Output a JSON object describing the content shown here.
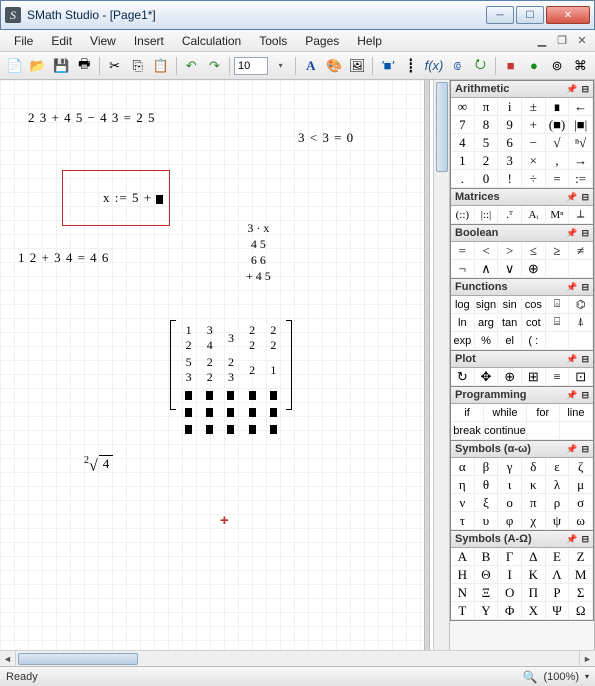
{
  "window": {
    "title": "SMath Studio - [Page1*]",
    "app_icon_letter": "S"
  },
  "menu": {
    "items": [
      "File",
      "Edit",
      "View",
      "Insert",
      "Calculation",
      "Tools",
      "Pages",
      "Help"
    ]
  },
  "toolbar": {
    "font_size": "10"
  },
  "canvas": {
    "expr1": "2 3 + 4 5 − 4 3 = 2 5",
    "expr2": "3 < 3 = 0",
    "sel_expr": "x := 5 + ",
    "expr3": "1 2 + 3 4 = 4 6",
    "col_lines": [
      "3 · x",
      "4 5",
      "6 6",
      "+ 4 5"
    ],
    "sqrt_idx": "2",
    "sqrt_arg": "4",
    "matrix": [
      [
        "1 2",
        "3 4",
        "3",
        "2 2",
        "2 2"
      ],
      [
        "5 3",
        "2 2",
        "2 3",
        "2",
        "1"
      ],
      [
        "■",
        "■",
        "■",
        "■",
        "■"
      ],
      [
        "■",
        "■",
        "■",
        "■",
        "■"
      ],
      [
        "■",
        "■",
        "■",
        "■",
        "■"
      ]
    ]
  },
  "panels": {
    "arithmetic": {
      "title": "Arithmetic",
      "rows": [
        [
          "∞",
          "π",
          "i",
          "±",
          "∎",
          "←"
        ],
        [
          "7",
          "8",
          "9",
          "+",
          "(■)",
          "|■|"
        ],
        [
          "4",
          "5",
          "6",
          "−",
          "√",
          "ⁿ√"
        ],
        [
          "1",
          "2",
          "3",
          "×",
          ",",
          "→"
        ],
        [
          ".",
          "0",
          "!",
          "÷",
          "=",
          ":="
        ]
      ]
    },
    "matrices": {
      "title": "Matrices",
      "rows": [
        [
          "(::)",
          "|::|",
          ".ᵀ",
          "Aᵢ",
          "Mⁿ",
          "⟂"
        ]
      ]
    },
    "boolean": {
      "title": "Boolean",
      "rows": [
        [
          "=",
          "<",
          ">",
          "≤",
          "≥",
          "≠"
        ],
        [
          "¬",
          "∧",
          "∨",
          "⊕",
          "",
          ""
        ]
      ]
    },
    "functions": {
      "title": "Functions",
      "rows": [
        [
          "log",
          "sign",
          "sin",
          "cos",
          "⌺",
          "⌬"
        ],
        [
          "ln",
          "arg",
          "tan",
          "cot",
          "⌸",
          "⍋"
        ],
        [
          "exp",
          "%",
          "el",
          "( :",
          "",
          ""
        ]
      ]
    },
    "plot": {
      "title": "Plot",
      "rows": [
        [
          "↻",
          "✥",
          "⊕",
          "⊞",
          "≡",
          "⊡"
        ]
      ]
    },
    "programming": {
      "title": "Programming",
      "rows": [
        [
          "if",
          "while",
          "for",
          "line"
        ],
        [
          "break",
          "continue",
          "",
          ""
        ]
      ]
    },
    "sym_lower": {
      "title": "Symbols (α-ω)",
      "rows": [
        [
          "α",
          "β",
          "γ",
          "δ",
          "ε",
          "ζ"
        ],
        [
          "η",
          "θ",
          "ι",
          "κ",
          "λ",
          "μ"
        ],
        [
          "ν",
          "ξ",
          "ο",
          "π",
          "ρ",
          "σ"
        ],
        [
          "τ",
          "υ",
          "φ",
          "χ",
          "ψ",
          "ω"
        ]
      ]
    },
    "sym_upper": {
      "title": "Symbols (Α-Ω)",
      "rows": [
        [
          "Α",
          "Β",
          "Γ",
          "Δ",
          "Ε",
          "Ζ"
        ],
        [
          "Η",
          "Θ",
          "Ι",
          "Κ",
          "Λ",
          "Μ"
        ],
        [
          "Ν",
          "Ξ",
          "Ο",
          "Π",
          "Ρ",
          "Σ"
        ],
        [
          "Τ",
          "Υ",
          "Φ",
          "Χ",
          "Ψ",
          "Ω"
        ]
      ]
    }
  },
  "status": {
    "text": "Ready",
    "zoom": "(100%)"
  }
}
